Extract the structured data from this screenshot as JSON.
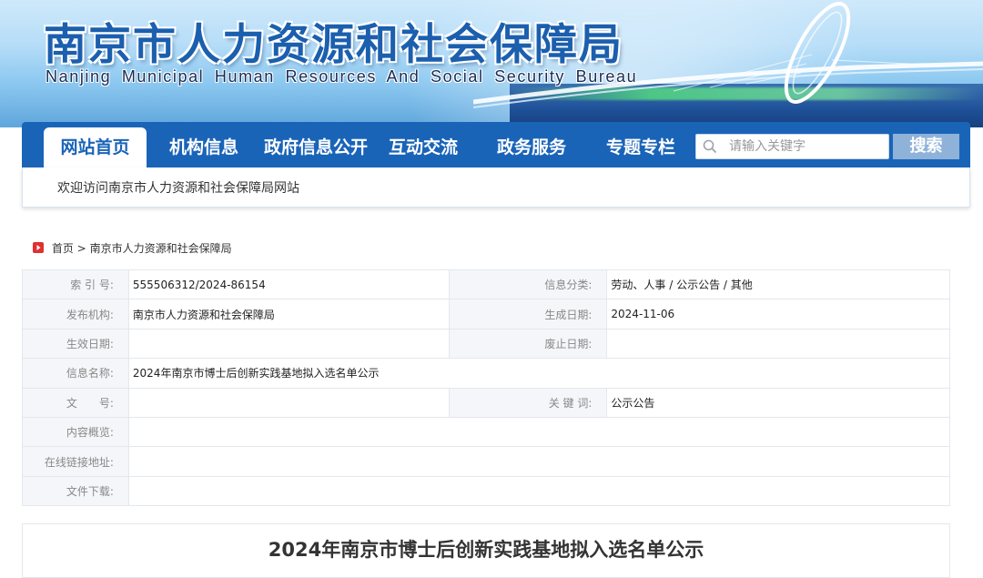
{
  "header": {
    "title_cn": "南京市人力资源和社会保障局",
    "title_en": "Nanjing Municipal Human Resources And Social Security Bureau"
  },
  "nav": {
    "items": [
      {
        "label": "网站首页",
        "active": true
      },
      {
        "label": "机构信息",
        "active": false
      },
      {
        "label": "政府信息公开",
        "active": false
      },
      {
        "label": "互动交流",
        "active": false
      },
      {
        "label": "政务服务",
        "active": false
      },
      {
        "label": "专题专栏",
        "active": false
      }
    ],
    "search_placeholder": "请输入关键字",
    "search_button": "搜索"
  },
  "welcome": "欢迎访问南京市人力资源和社会保障局网站",
  "breadcrumb": {
    "home": "首页",
    "separator": ">",
    "current": "南京市人力资源和社会保障局"
  },
  "info": {
    "index_label": "索 引 号:",
    "index_value": "555506312/2024-86154",
    "category_label": "信息分类:",
    "category_value": "劳动、人事 / 公示公告 / 其他",
    "publisher_label": "发布机构:",
    "publisher_value": "南京市人力资源和社会保障局",
    "created_label": "生成日期:",
    "created_value": "2024-11-06",
    "effective_label": "生效日期:",
    "effective_value": "",
    "expiry_label": "废止日期:",
    "expiry_value": "",
    "name_label": "信息名称:",
    "name_value": "2024年南京市博士后创新实践基地拟入选名单公示",
    "docno_label": "文　　号:",
    "docno_value": "",
    "keywords_label": "关 键 词:",
    "keywords_value": "公示公告",
    "summary_label": "内容概览:",
    "summary_value": "",
    "link_label": "在线链接地址:",
    "link_value": "",
    "download_label": "文件下载:",
    "download_value": ""
  },
  "article": {
    "title": "2024年南京市博士后创新实践基地拟入选名单公示"
  },
  "colors": {
    "nav_bg": "#1a64b8",
    "title_blue": "#1b5fae",
    "label_bg": "#f4f6f9",
    "search_btn": "#8fb2d9",
    "home_icon": "#e03030"
  }
}
